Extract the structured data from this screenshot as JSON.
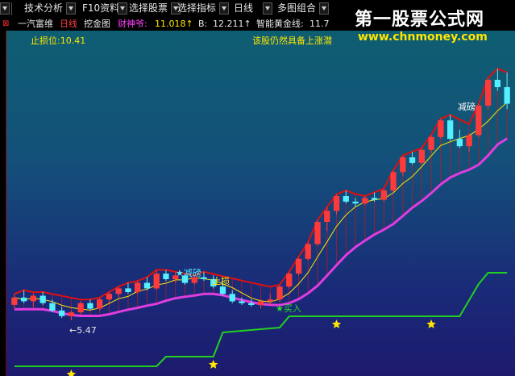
{
  "toolbar": {
    "items": [
      "技术分析",
      "F10资料",
      "选择股票",
      "选择指标",
      "日线",
      "多图组合"
    ]
  },
  "info": {
    "stock_name": "一汽富维",
    "period": "日线",
    "indicator": "挖金图",
    "caishen_label": "财神爷:",
    "caishen_value": "11.018↑",
    "b_label": "B:",
    "b_value": "12.211↑",
    "gold_label": "智能黄金线:",
    "gold_value": "11.7"
  },
  "annotations": {
    "stop_loss_level": "止损位:10.41",
    "advice": "该股仍然具备上涨潜",
    "reduce1": "★减磅",
    "stop": "止损",
    "buy": "★买入",
    "reduce2": "减磅",
    "low_price": "←5.47"
  },
  "watermark": {
    "title": "第一股票公式网",
    "url": "www.chnmoney.com"
  },
  "colors": {
    "up": "#ff3a3a",
    "down": "#54f0ff",
    "ma_yellow": "#ffe600",
    "trend_magenta": "#e03ce0",
    "green_line": "#22d022",
    "red_band": "#e01010",
    "star": "#ffe600"
  },
  "chart_data": {
    "type": "candlestick",
    "title": "",
    "candles": [
      {
        "o": 6.3,
        "h": 6.9,
        "l": 6.1,
        "c": 6.7
      },
      {
        "o": 6.7,
        "h": 7.1,
        "l": 6.4,
        "c": 6.5
      },
      {
        "o": 6.5,
        "h": 6.9,
        "l": 6.2,
        "c": 6.8
      },
      {
        "o": 6.8,
        "h": 7.0,
        "l": 6.3,
        "c": 6.4
      },
      {
        "o": 6.4,
        "h": 6.6,
        "l": 5.9,
        "c": 6.0
      },
      {
        "o": 6.0,
        "h": 6.2,
        "l": 5.6,
        "c": 5.7
      },
      {
        "o": 5.7,
        "h": 6.0,
        "l": 5.47,
        "c": 5.9
      },
      {
        "o": 5.9,
        "h": 6.5,
        "l": 5.8,
        "c": 6.4
      },
      {
        "o": 6.4,
        "h": 6.6,
        "l": 6.0,
        "c": 6.1
      },
      {
        "o": 6.1,
        "h": 6.7,
        "l": 6.0,
        "c": 6.6
      },
      {
        "o": 6.6,
        "h": 7.0,
        "l": 6.4,
        "c": 6.9
      },
      {
        "o": 6.9,
        "h": 7.3,
        "l": 6.7,
        "c": 7.2
      },
      {
        "o": 7.2,
        "h": 7.5,
        "l": 6.9,
        "c": 7.0
      },
      {
        "o": 7.0,
        "h": 7.6,
        "l": 6.9,
        "c": 7.5
      },
      {
        "o": 7.5,
        "h": 7.8,
        "l": 7.1,
        "c": 7.2
      },
      {
        "o": 7.2,
        "h": 8.2,
        "l": 7.1,
        "c": 8.0
      },
      {
        "o": 8.0,
        "h": 8.2,
        "l": 7.6,
        "c": 7.7
      },
      {
        "o": 7.7,
        "h": 8.1,
        "l": 7.5,
        "c": 7.9
      },
      {
        "o": 7.9,
        "h": 8.0,
        "l": 7.4,
        "c": 7.5
      },
      {
        "o": 7.5,
        "h": 7.9,
        "l": 7.4,
        "c": 7.8
      },
      {
        "o": 7.8,
        "h": 8.1,
        "l": 7.6,
        "c": 7.7
      },
      {
        "o": 7.7,
        "h": 7.9,
        "l": 7.2,
        "c": 7.3
      },
      {
        "o": 7.3,
        "h": 7.6,
        "l": 6.8,
        "c": 6.9
      },
      {
        "o": 6.9,
        "h": 7.1,
        "l": 6.4,
        "c": 6.5
      },
      {
        "o": 6.5,
        "h": 6.7,
        "l": 6.3,
        "c": 6.4
      },
      {
        "o": 6.4,
        "h": 6.6,
        "l": 6.2,
        "c": 6.3
      },
      {
        "o": 6.3,
        "h": 6.6,
        "l": 6.1,
        "c": 6.5
      },
      {
        "o": 6.5,
        "h": 6.9,
        "l": 6.3,
        "c": 6.6
      },
      {
        "o": 6.6,
        "h": 7.4,
        "l": 6.5,
        "c": 7.3
      },
      {
        "o": 7.3,
        "h": 8.1,
        "l": 7.2,
        "c": 8.0
      },
      {
        "o": 8.0,
        "h": 8.9,
        "l": 7.9,
        "c": 8.8
      },
      {
        "o": 8.8,
        "h": 9.7,
        "l": 8.7,
        "c": 9.6
      },
      {
        "o": 9.6,
        "h": 10.9,
        "l": 9.5,
        "c": 10.8
      },
      {
        "o": 10.8,
        "h": 11.6,
        "l": 10.3,
        "c": 11.4
      },
      {
        "o": 11.4,
        "h": 12.3,
        "l": 11.2,
        "c": 12.2
      },
      {
        "o": 12.2,
        "h": 12.5,
        "l": 11.8,
        "c": 11.9
      },
      {
        "o": 11.9,
        "h": 12.1,
        "l": 11.6,
        "c": 11.8
      },
      {
        "o": 11.8,
        "h": 12.2,
        "l": 11.7,
        "c": 12.1
      },
      {
        "o": 12.1,
        "h": 12.4,
        "l": 11.9,
        "c": 12.0
      },
      {
        "o": 12.0,
        "h": 12.6,
        "l": 11.9,
        "c": 12.5
      },
      {
        "o": 12.5,
        "h": 13.6,
        "l": 12.4,
        "c": 13.5
      },
      {
        "o": 13.5,
        "h": 14.4,
        "l": 13.3,
        "c": 14.3
      },
      {
        "o": 14.3,
        "h": 14.6,
        "l": 13.9,
        "c": 14.0
      },
      {
        "o": 14.0,
        "h": 14.8,
        "l": 13.9,
        "c": 14.7
      },
      {
        "o": 14.7,
        "h": 15.5,
        "l": 14.5,
        "c": 15.4
      },
      {
        "o": 15.4,
        "h": 16.4,
        "l": 15.3,
        "c": 16.3
      },
      {
        "o": 16.3,
        "h": 16.6,
        "l": 15.2,
        "c": 15.3
      },
      {
        "o": 15.3,
        "h": 15.8,
        "l": 14.8,
        "c": 14.9
      },
      {
        "o": 14.9,
        "h": 15.6,
        "l": 14.6,
        "c": 15.5
      },
      {
        "o": 15.5,
        "h": 17.2,
        "l": 15.4,
        "c": 17.1
      },
      {
        "o": 17.1,
        "h": 18.6,
        "l": 16.9,
        "c": 18.5
      },
      {
        "o": 18.5,
        "h": 19.1,
        "l": 17.9,
        "c": 18.1
      },
      {
        "o": 18.1,
        "h": 18.9,
        "l": 16.9,
        "c": 17.2
      }
    ],
    "ylim": [
      4.2,
      20.2
    ],
    "markers": [
      {
        "type": "reduce",
        "index": 18
      },
      {
        "type": "buy",
        "index": 27
      },
      {
        "type": "reduce",
        "index": 47
      }
    ]
  }
}
